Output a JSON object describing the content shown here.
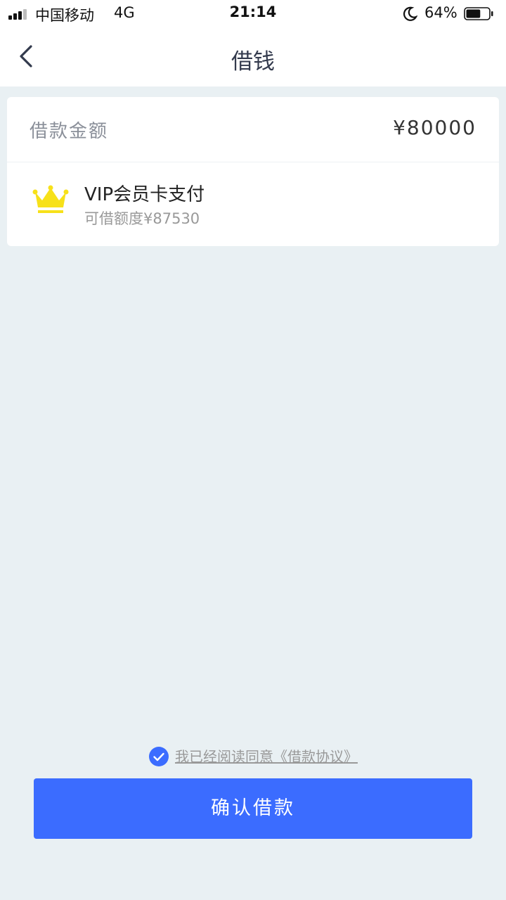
{
  "status_bar": {
    "carrier": "中国移动",
    "network": "4G",
    "time": "21:14",
    "battery_percent": "64%",
    "battery_level": 0.64,
    "signal_bars": 3,
    "icons": [
      "signal-icon",
      "moon-icon",
      "battery-icon"
    ]
  },
  "nav": {
    "title": "借钱",
    "back_icon": "chevron-left-icon"
  },
  "loan": {
    "amount_label": "借款金额",
    "amount_value": "¥80000"
  },
  "payment": {
    "icon": "crown-icon",
    "name": "VIP会员卡支付",
    "limit": "可借额度¥87530"
  },
  "agreement": {
    "checked": true,
    "text": "我已经阅读同意《借款协议》"
  },
  "confirm": {
    "label": "确认借款"
  },
  "colors": {
    "accent": "#3b6cff",
    "background": "#e9f0f3",
    "crown": "#f7e11a"
  }
}
